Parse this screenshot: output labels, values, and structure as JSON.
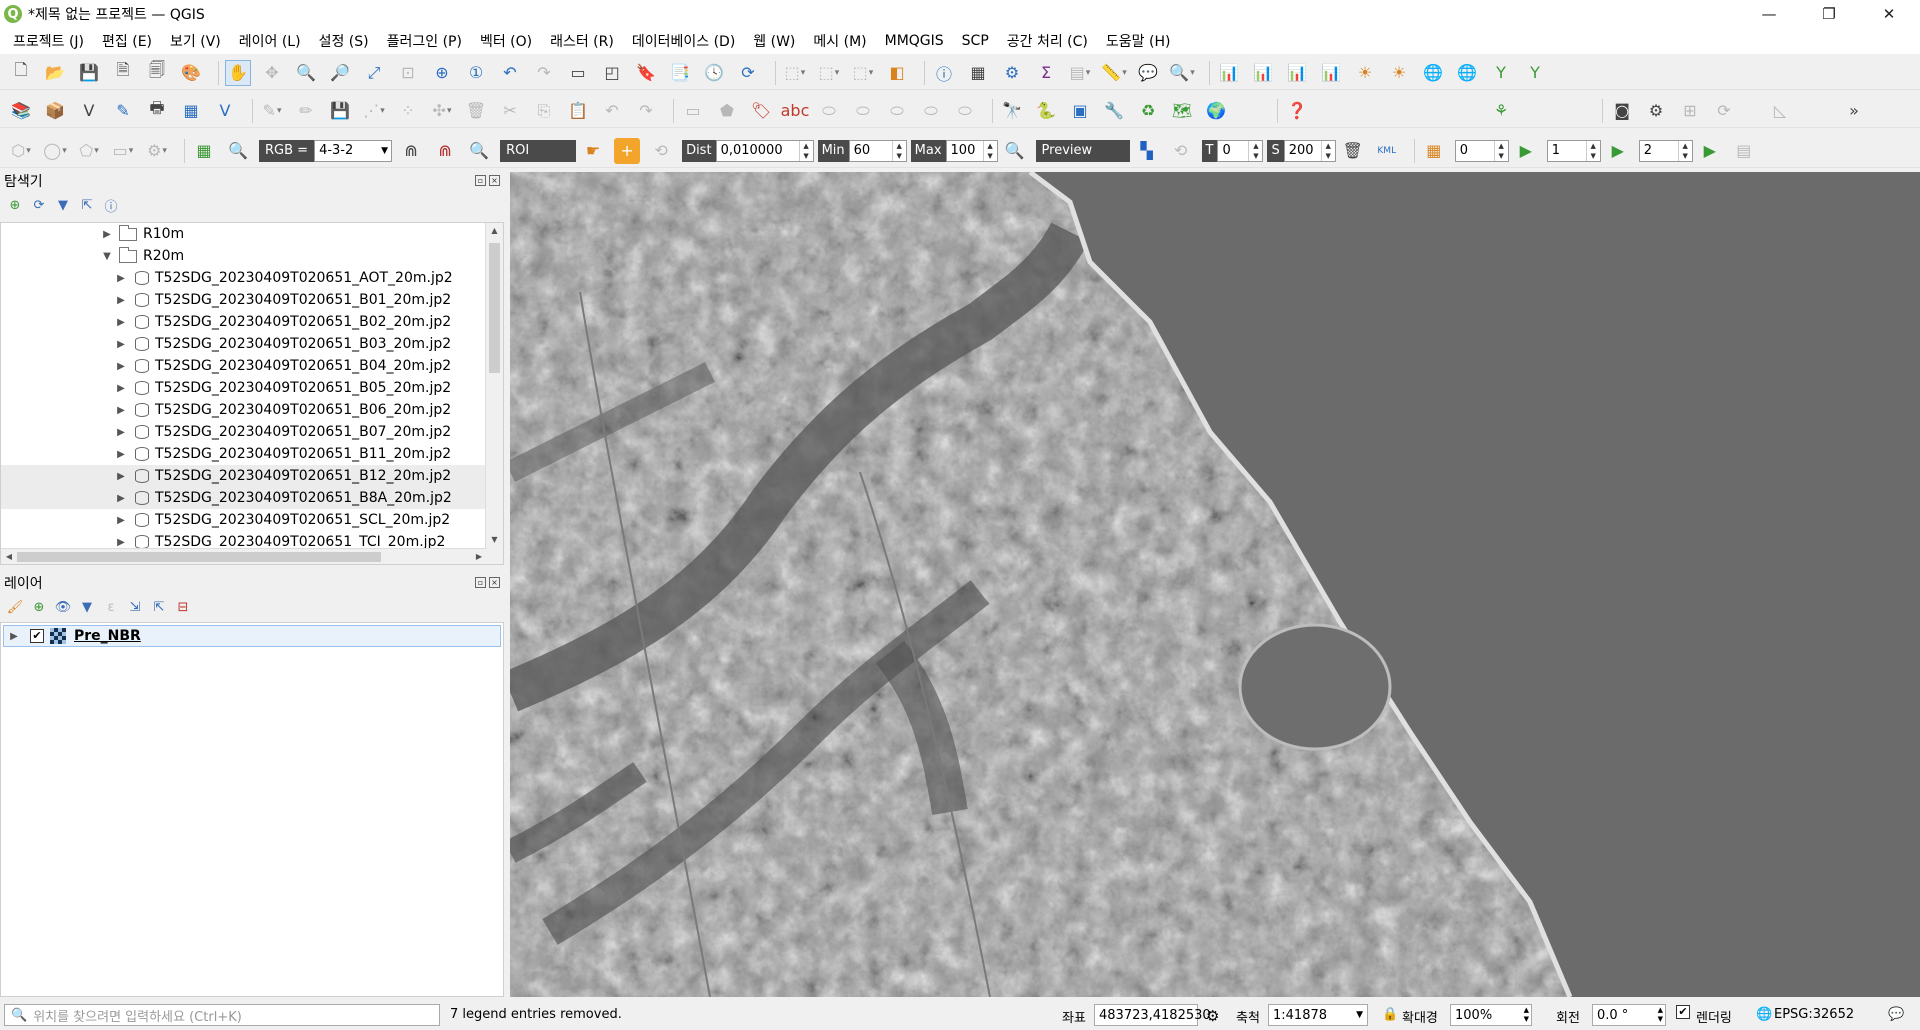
{
  "window": {
    "title": "*제목 없는 프로젝트 — QGIS",
    "logo_letter": "Q",
    "minimize": "—",
    "restore": "❐",
    "close": "✕"
  },
  "menu": [
    "프로젝트 (J)",
    "편집 (E)",
    "보기 (V)",
    "레이어 (L)",
    "설정 (S)",
    "플러그인 (P)",
    "벡터 (O)",
    "래스터 (R)",
    "데이터베이스 (D)",
    "웹 (W)",
    "메시 (M)",
    "MMQGIS",
    "SCP",
    "공간 처리 (C)",
    "도움말 (H)"
  ],
  "scp_toolbar": {
    "rgb_label": "RGB =",
    "rgb_value": "4-3-2",
    "roi_label": "ROI",
    "dist_label": "Dist",
    "dist_value": "0,010000",
    "min_label": "Min",
    "min_value": "60",
    "max_label": "Max",
    "max_value": "100",
    "preview_label": "Preview",
    "t_label": "T",
    "t_value": "0",
    "s_label": "S",
    "s_value": "200",
    "kml_label": "KML",
    "v1": "0",
    "v2": "1",
    "v3": "2"
  },
  "browser": {
    "title": "탐색기",
    "items": [
      {
        "label": "R10m",
        "type": "folder",
        "expanded": false
      },
      {
        "label": "R20m",
        "type": "folder",
        "expanded": true
      },
      {
        "label": "T52SDG_20230409T020651_AOT_20m.jp2",
        "type": "raster"
      },
      {
        "label": "T52SDG_20230409T020651_B01_20m.jp2",
        "type": "raster"
      },
      {
        "label": "T52SDG_20230409T020651_B02_20m.jp2",
        "type": "raster"
      },
      {
        "label": "T52SDG_20230409T020651_B03_20m.jp2",
        "type": "raster"
      },
      {
        "label": "T52SDG_20230409T020651_B04_20m.jp2",
        "type": "raster"
      },
      {
        "label": "T52SDG_20230409T020651_B05_20m.jp2",
        "type": "raster"
      },
      {
        "label": "T52SDG_20230409T020651_B06_20m.jp2",
        "type": "raster"
      },
      {
        "label": "T52SDG_20230409T020651_B07_20m.jp2",
        "type": "raster"
      },
      {
        "label": "T52SDG_20230409T020651_B11_20m.jp2",
        "type": "raster"
      },
      {
        "label": "T52SDG_20230409T020651_B12_20m.jp2",
        "type": "raster",
        "highlight": true
      },
      {
        "label": "T52SDG_20230409T020651_B8A_20m.jp2",
        "type": "raster",
        "highlight": true
      },
      {
        "label": "T52SDG_20230409T020651_SCL_20m.jp2",
        "type": "raster"
      },
      {
        "label": "T52SDG_20230409T020651_TCI_20m.jp2",
        "type": "raster"
      }
    ]
  },
  "layers": {
    "title": "레이어",
    "items": [
      {
        "name": "Pre_NBR",
        "checked": true
      }
    ]
  },
  "statusbar": {
    "locator_placeholder": "위치를 찾으려면 입력하세요 (Ctrl+K)",
    "message": "7 legend entries removed.",
    "coord_label": "좌표",
    "coord_value": "483723,4182530",
    "scale_label": "축척",
    "scale_value": "1:41878",
    "magnifier_label": "확대경",
    "magnifier_value": "100%",
    "rotation_label": "회전",
    "rotation_value": "0.0 °",
    "render_label": "렌더링",
    "crs": "EPSG:32652"
  },
  "colors": {
    "sea": "#6b6b6b",
    "land_dark": "#4e4e4e",
    "land_light": "#d4d4d4",
    "selection": "#e9f1fb",
    "accent_green": "#7ab648"
  }
}
